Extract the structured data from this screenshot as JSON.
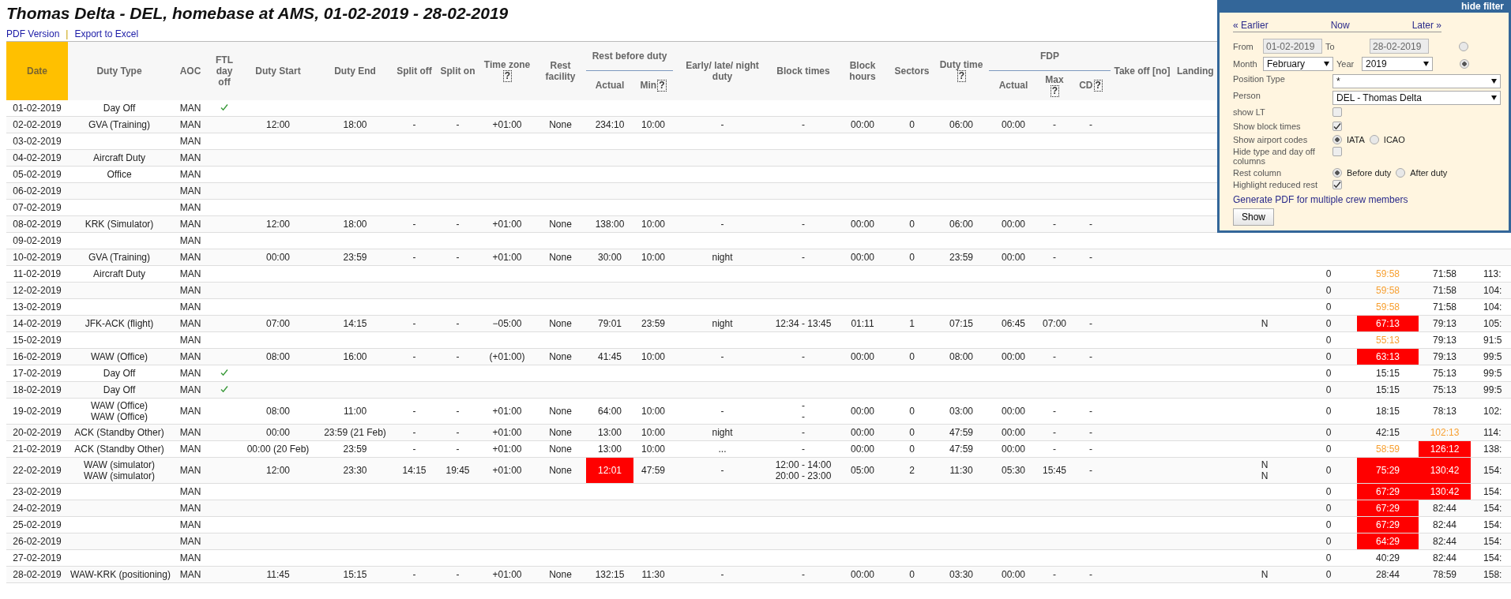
{
  "title": "Thomas Delta - DEL, homebase at AMS, 01-02-2019 - 28-02-2019",
  "links": [
    {
      "label": "PDF Version"
    },
    {
      "label": "Export to Excel"
    }
  ],
  "link_separator": "|",
  "table": {
    "columns": [
      {
        "label": "Date",
        "highlighted": true
      },
      {
        "label": "Duty Type",
        "highlighted": false
      },
      {
        "label": "AOC",
        "highlighted": false
      },
      {
        "label": "FTL day off",
        "highlighted": false
      },
      {
        "label": "Duty Start",
        "highlighted": false
      },
      {
        "label": "Duty End",
        "highlighted": false
      },
      {
        "label": "Split off",
        "highlighted": false
      },
      {
        "label": "Split on",
        "highlighted": false
      },
      {
        "label": "Time zone",
        "help": "?",
        "highlighted": false
      },
      {
        "label": "Rest facility",
        "highlighted": false
      },
      {
        "label": "Rest before duty",
        "highlighted": false,
        "subcolumns": [
          {
            "label": "Actual"
          },
          {
            "label": "Min",
            "help": "?"
          }
        ]
      },
      {
        "label": "Early/ late/ night duty",
        "highlighted": false
      },
      {
        "label": "Block times",
        "highlighted": false
      },
      {
        "label": "Block hours",
        "highlighted": false
      },
      {
        "label": "Sectors",
        "highlighted": false
      },
      {
        "label": "Duty time",
        "help": "?",
        "highlighted": false
      },
      {
        "label": "FDP",
        "highlighted": false,
        "subcolumns": [
          {
            "label": "Actual"
          },
          {
            "label": "Max",
            "help": "?"
          },
          {
            "label": "CD",
            "help": "?"
          }
        ]
      },
      {
        "label": "Take off [no]",
        "highlighted": false
      },
      {
        "label": "Landing",
        "highlighted": false
      }
    ],
    "rows": [
      {
        "date": "01-02-2019",
        "duty_type": [
          "Day Off"
        ],
        "aoc": "MAN",
        "ftl_day_off": true
      },
      {
        "date": "02-02-2019",
        "duty_type": [
          "GVA (Training)"
        ],
        "aoc": "MAN",
        "ftl_day_off": false,
        "duty": [
          "12:00",
          "18:00",
          "-",
          "-",
          "+01:00",
          "None",
          "234:10",
          "10:00",
          "-",
          "-",
          "00:00",
          "0",
          "06:00",
          "00:00",
          "-",
          "-"
        ]
      },
      {
        "date": "03-02-2019",
        "aoc": "MAN",
        "ftl_day_off": false
      },
      {
        "date": "04-02-2019",
        "duty_type": [
          "Aircraft Duty"
        ],
        "aoc": "MAN",
        "ftl_day_off": false
      },
      {
        "date": "05-02-2019",
        "duty_type": [
          "Office"
        ],
        "aoc": "MAN",
        "ftl_day_off": false
      },
      {
        "date": "06-02-2019",
        "aoc": "MAN",
        "ftl_day_off": false
      },
      {
        "date": "07-02-2019",
        "aoc": "MAN",
        "ftl_day_off": false
      },
      {
        "date": "08-02-2019",
        "duty_type": [
          "KRK (Simulator)"
        ],
        "aoc": "MAN",
        "ftl_day_off": false,
        "duty": [
          "12:00",
          "18:00",
          "-",
          "-",
          "+01:00",
          "None",
          "138:00",
          "10:00",
          "-",
          "-",
          "00:00",
          "0",
          "06:00",
          "00:00",
          "-",
          "-"
        ]
      },
      {
        "date": "09-02-2019",
        "aoc": "MAN",
        "ftl_day_off": false
      },
      {
        "date": "10-02-2019",
        "duty_type": [
          "GVA (Training)"
        ],
        "aoc": "MAN",
        "ftl_day_off": false,
        "duty": [
          "00:00",
          "23:59",
          "-",
          "-",
          "+01:00",
          "None",
          "30:00",
          "10:00",
          "night",
          "-",
          "00:00",
          "0",
          "23:59",
          "00:00",
          "-",
          "-"
        ]
      },
      {
        "date": "11-02-2019",
        "duty_type": [
          "Aircraft Duty"
        ],
        "aoc": "MAN",
        "ftl_day_off": false,
        "totals": {
          "column_24": "0",
          "column_25": {
            "text": "59:58",
            "near_limit": true
          },
          "column_26": "71:58",
          "column_27": "113:"
        }
      },
      {
        "date": "12-02-2019",
        "aoc": "MAN",
        "ftl_day_off": false,
        "totals": {
          "column_24": "0",
          "column_25": {
            "text": "59:58",
            "near_limit": true
          },
          "column_26": "71:58",
          "column_27": "104:"
        }
      },
      {
        "date": "13-02-2019",
        "aoc": "MAN",
        "ftl_day_off": false,
        "totals": {
          "column_24": "0",
          "column_25": {
            "text": "59:58",
            "near_limit": true
          },
          "column_26": "71:58",
          "column_27": "104:"
        }
      },
      {
        "date": "14-02-2019",
        "duty_type": [
          "JFK-ACK (flight)"
        ],
        "aoc": "MAN",
        "ftl_day_off": false,
        "duty": [
          "07:00",
          "14:15",
          "-",
          "-",
          "−05:00",
          "None",
          "79:01",
          "23:59",
          "night",
          [
            "12:34 - 13:45"
          ],
          "01:11",
          "1",
          "07:15",
          "06:45",
          "07:00",
          "-"
        ],
        "totals": {
          "column_23": [
            "N"
          ],
          "column_24": "0",
          "column_25": {
            "text": "67:13",
            "exceeded": true
          },
          "column_26": "79:13",
          "column_27": "105:"
        }
      },
      {
        "date": "15-02-2019",
        "aoc": "MAN",
        "ftl_day_off": false,
        "totals": {
          "column_24": "0",
          "column_25": {
            "text": "55:13",
            "near_limit": true
          },
          "column_26": "79:13",
          "column_27": "91:5"
        }
      },
      {
        "date": "16-02-2019",
        "duty_type": [
          "WAW (Office)"
        ],
        "aoc": "MAN",
        "ftl_day_off": false,
        "duty": [
          "08:00",
          "16:00",
          "-",
          "-",
          "(+01:00)",
          "None",
          "41:45",
          "10:00",
          "-",
          "-",
          "00:00",
          "0",
          "08:00",
          "00:00",
          "-",
          "-"
        ],
        "totals": {
          "column_24": "0",
          "column_25": {
            "text": "63:13",
            "exceeded": true
          },
          "column_26": "79:13",
          "column_27": "99:5"
        }
      },
      {
        "date": "17-02-2019",
        "duty_type": [
          "Day Off"
        ],
        "aoc": "MAN",
        "ftl_day_off": true,
        "totals": {
          "column_24": "0",
          "column_25": "15:15",
          "column_26": "75:13",
          "column_27": "99:5"
        }
      },
      {
        "date": "18-02-2019",
        "duty_type": [
          "Day Off"
        ],
        "aoc": "MAN",
        "ftl_day_off": true,
        "totals": {
          "column_24": "0",
          "column_25": "15:15",
          "column_26": "75:13",
          "column_27": "99:5"
        }
      },
      {
        "date": "19-02-2019",
        "duty_type": [
          "WAW (Office)",
          "WAW (Office)"
        ],
        "aoc": "MAN",
        "ftl_day_off": false,
        "duty": [
          "08:00",
          "11:00",
          "-",
          "-",
          "+01:00",
          "None",
          "64:00",
          "10:00",
          "-",
          [
            "-",
            "-"
          ],
          "00:00",
          "0",
          "03:00",
          "00:00",
          "-",
          "-"
        ],
        "totals": {
          "column_24": "0",
          "column_25": "18:15",
          "column_26": "78:13",
          "column_27": "102:"
        }
      },
      {
        "date": "20-02-2019",
        "duty_type": [
          "ACK (Standby Other)"
        ],
        "aoc": "MAN",
        "ftl_day_off": false,
        "duty": [
          "00:00",
          "23:59 (21 Feb)",
          "-",
          "-",
          "+01:00",
          "None",
          "13:00",
          "10:00",
          "night",
          "-",
          "00:00",
          "0",
          "47:59",
          "00:00",
          "-",
          "-"
        ],
        "totals": {
          "column_24": "0",
          "column_25": "42:15",
          "column_26": {
            "text": "102:13",
            "near_limit": true
          },
          "column_27": "114:"
        }
      },
      {
        "date": "21-02-2019",
        "duty_type": [
          "ACK (Standby Other)"
        ],
        "aoc": "MAN",
        "ftl_day_off": false,
        "duty": [
          "00:00 (20 Feb)",
          "23:59",
          "-",
          "-",
          "+01:00",
          "None",
          "13:00",
          "10:00",
          "...",
          "-",
          "00:00",
          "0",
          "47:59",
          "00:00",
          "-",
          "-"
        ],
        "totals": {
          "column_24": "0",
          "column_25": {
            "text": "58:59",
            "near_limit": true
          },
          "column_26": {
            "text": "126:12",
            "exceeded": true
          },
          "column_27": "138:"
        }
      },
      {
        "date": "22-02-2019",
        "duty_type": [
          "WAW (simulator)",
          "WAW (simulator)"
        ],
        "aoc": "MAN",
        "ftl_day_off": false,
        "duty": [
          "12:00",
          "23:30",
          "14:15",
          "19:45",
          "+01:00",
          "None",
          {
            "text": "12:01",
            "exceeded": true
          },
          "47:59",
          "-",
          [
            "12:00 - 14:00",
            "20:00 - 23:00"
          ],
          "05:00",
          "2",
          "11:30",
          "05:30",
          "15:45",
          "-"
        ],
        "totals": {
          "column_23": [
            "N",
            "N"
          ],
          "column_24": "0",
          "column_25": {
            "text": "75:29",
            "exceeded": true
          },
          "column_26": {
            "text": "130:42",
            "exceeded": true
          },
          "column_27": "154:"
        }
      },
      {
        "date": "23-02-2019",
        "aoc": "MAN",
        "ftl_day_off": false,
        "totals": {
          "column_24": "0",
          "column_25": {
            "text": "67:29",
            "exceeded": true
          },
          "column_26": {
            "text": "130:42",
            "exceeded": true
          },
          "column_27": "154:"
        }
      },
      {
        "date": "24-02-2019",
        "aoc": "MAN",
        "ftl_day_off": false,
        "totals": {
          "column_24": "0",
          "column_25": {
            "text": "67:29",
            "exceeded": true
          },
          "column_26": "82:44",
          "column_27": "154:"
        }
      },
      {
        "date": "25-02-2019",
        "aoc": "MAN",
        "ftl_day_off": false,
        "totals": {
          "column_24": "0",
          "column_25": {
            "text": "67:29",
            "exceeded": true
          },
          "column_26": "82:44",
          "column_27": "154:"
        }
      },
      {
        "date": "26-02-2019",
        "aoc": "MAN",
        "ftl_day_off": false,
        "totals": {
          "column_24": "0",
          "column_25": {
            "text": "64:29",
            "exceeded": true
          },
          "column_26": "82:44",
          "column_27": "154:"
        }
      },
      {
        "date": "27-02-2019",
        "aoc": "MAN",
        "ftl_day_off": false,
        "totals": {
          "column_24": "0",
          "column_25": "40:29",
          "column_26": "82:44",
          "column_27": "154:"
        }
      },
      {
        "date": "28-02-2019",
        "duty_type": [
          "WAW-KRK (positioning)"
        ],
        "aoc": "MAN",
        "ftl_day_off": false,
        "duty": [
          "11:45",
          "15:15",
          "-",
          "-",
          "+01:00",
          "None",
          "132:15",
          "11:30",
          "-",
          "-",
          "00:00",
          "0",
          "03:30",
          "00:00",
          "-",
          "-"
        ],
        "totals": {
          "column_23": [
            "N"
          ],
          "column_24": "0",
          "column_25": "28:44",
          "column_26": "78:59",
          "column_27": "158:"
        }
      }
    ]
  },
  "filter": {
    "toggle": "hide filter",
    "nav": [
      {
        "label": "« Earlier"
      },
      {
        "label": "Now"
      },
      {
        "label": "Later »"
      }
    ],
    "date_range": {
      "from_label": "From",
      "from": "01-02-2019",
      "to_label": "To",
      "to": "28-02-2019",
      "selected": false
    },
    "month_range": {
      "month_label": "Month",
      "month": "February",
      "year_label": "Year",
      "year": "2019",
      "selected": true
    },
    "fields": [
      {
        "kind": "select",
        "label": "Position Type",
        "value": "*"
      },
      {
        "kind": "select",
        "label": "Person",
        "value": "DEL - Thomas Delta"
      },
      {
        "kind": "checkbox",
        "label": "show LT",
        "checked": false
      },
      {
        "kind": "checkbox",
        "label": "Show block times",
        "checked": true
      },
      {
        "kind": "radios",
        "label": "Show airport codes",
        "options": [
          {
            "label": "IATA",
            "selected": true
          },
          {
            "label": "ICAO",
            "selected": false
          }
        ]
      },
      {
        "kind": "checkbox",
        "label": "Hide type and day off columns",
        "checked": false
      },
      {
        "kind": "radios",
        "label": "Rest column",
        "options": [
          {
            "label": "Before duty",
            "selected": true
          },
          {
            "label": "After duty",
            "selected": false
          }
        ]
      },
      {
        "kind": "checkbox",
        "label": "Highlight reduced rest",
        "checked": true
      }
    ],
    "link": "Generate PDF for multiple crew members",
    "button": "Show"
  }
}
